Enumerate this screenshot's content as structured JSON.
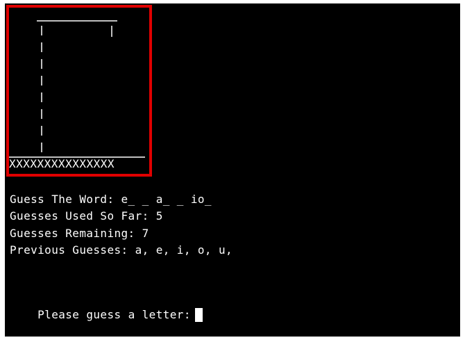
{
  "hangman": {
    "floor_marks": "XXXXXXXXXXXXXXX"
  },
  "lines": {
    "guess_word": "Guess The Word: e_ _ a_ _ io_",
    "guesses_used": "Guesses Used So Far: 5",
    "guesses_remaining": "Guesses Remaining: 7",
    "previous_guesses": "Previous Guesses: a, e, i, o, u,",
    "prompt": "Please guess a letter:"
  },
  "colors": {
    "background": "#000000",
    "text": "#ffffff",
    "highlight": "#e00000"
  }
}
